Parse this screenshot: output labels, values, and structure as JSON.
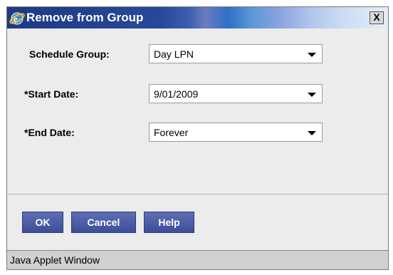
{
  "window": {
    "title": "Remove from Group",
    "close_label": "X"
  },
  "form": {
    "schedule_group": {
      "label": "Schedule Group:",
      "value": "Day LPN"
    },
    "start_date": {
      "label": "*Start Date:",
      "value": "9/01/2009"
    },
    "end_date": {
      "label": "*End Date:",
      "value": "Forever"
    }
  },
  "buttons": {
    "ok": "OK",
    "cancel": "Cancel",
    "help": "Help"
  },
  "status": {
    "text": "Java Applet Window"
  }
}
